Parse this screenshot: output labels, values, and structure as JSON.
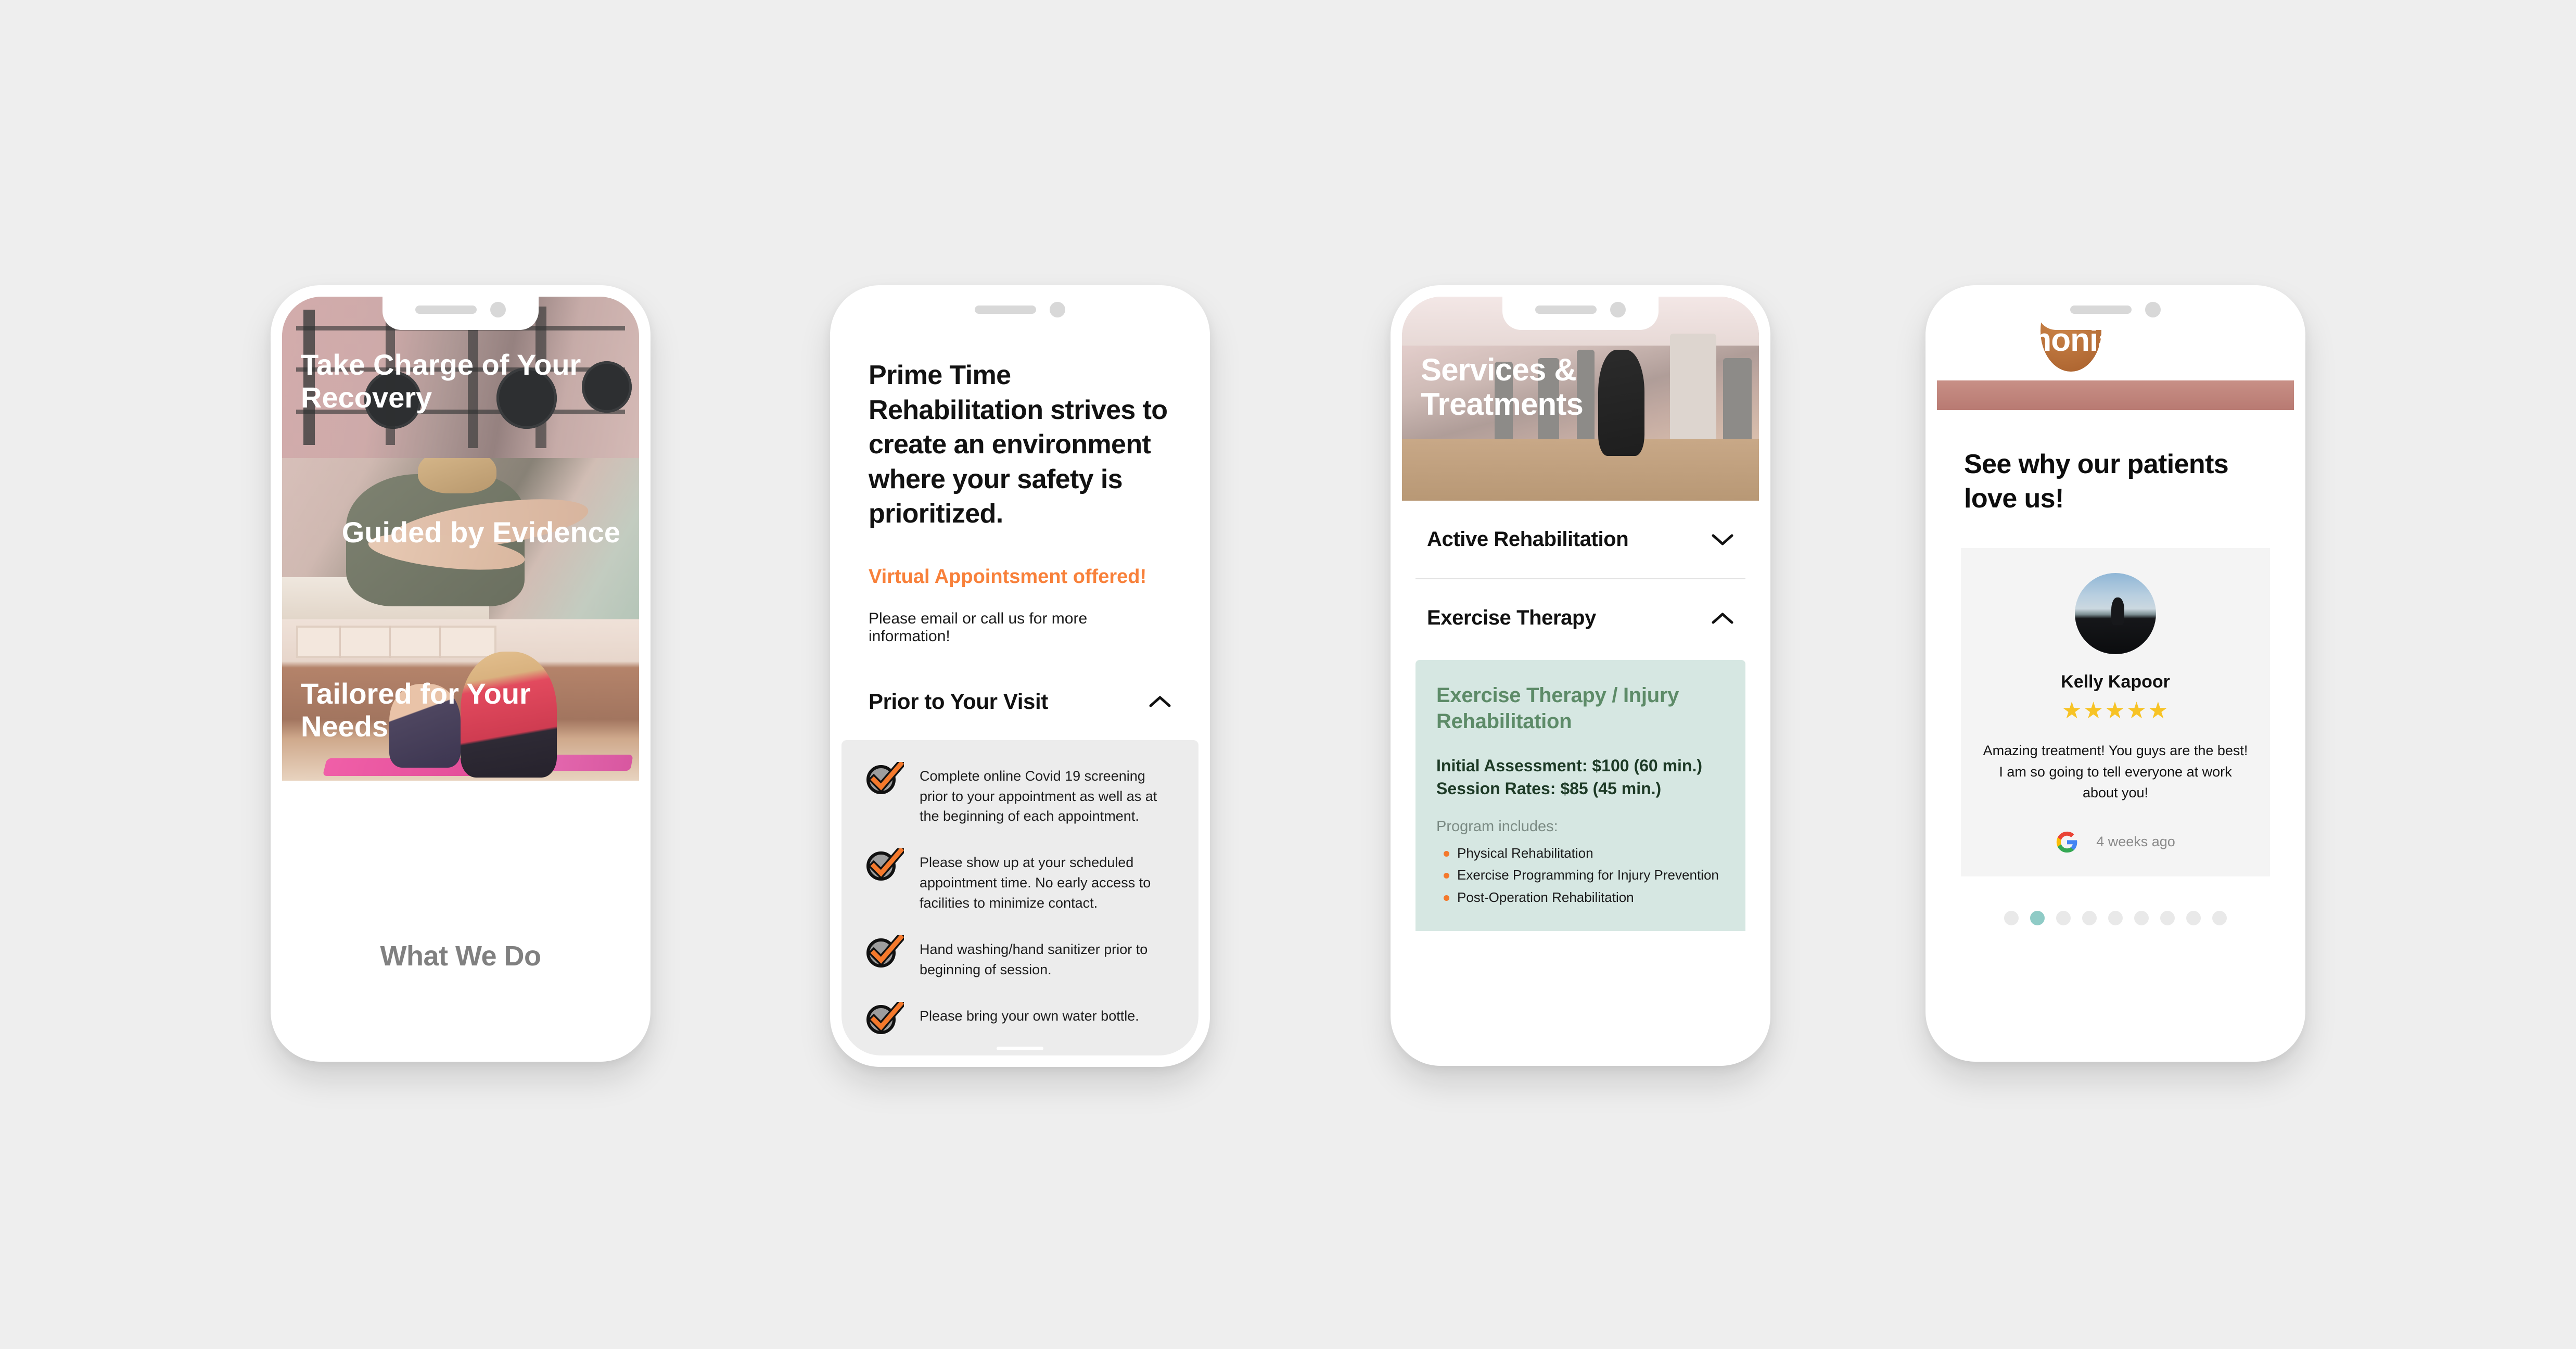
{
  "background_color": "#eeeeee",
  "accent_colors": {
    "orange": "#f8813b",
    "green_text": "#5d8b68",
    "green_panel": "#d6e7e2",
    "teal_dot": "#8fcbc6",
    "star_yellow": "#f7c325",
    "gray_text": "#808080"
  },
  "phone1": {
    "name": "what-we-do-slides",
    "slides": [
      {
        "caption": "Take Charge of Your Recovery",
        "align": "left",
        "image": "gym-squat-rack-photo"
      },
      {
        "caption": "Guided by Evidence",
        "align": "right",
        "image": "therapist-back-treatment-photo"
      },
      {
        "caption": "Tailored for Your Needs",
        "align": "left",
        "image": "women-stretching-on-mats-photo"
      }
    ],
    "section_label": "What We Do"
  },
  "phone2": {
    "name": "safety-prior-to-visit",
    "headline": "Prime Time Rehabilitation strives to create an environment where your safety is prioritized.",
    "virtual_notice": "Virtual Appointsment offered!",
    "subtext": "Please email or call us for more information!",
    "accordion": {
      "label": "Prior to Your Visit",
      "state": "expanded",
      "chevron": "chevron-up-icon"
    },
    "checklist": [
      "Complete online Covid 19 screening prior to your appointment as well as at the beginning of each appointment.",
      "Please show up at your scheduled appointment time. No early access to facilities to minimize contact.",
      "Hand washing/hand sanitizer prior to beginning of session.",
      "Please bring your own water bottle."
    ]
  },
  "phone3": {
    "name": "services-and-treatments",
    "hero_title": "Services & Treatments",
    "hero_image": "gym-interior-photo",
    "accordions": [
      {
        "label": "Active Rehabilitation",
        "state": "collapsed",
        "chevron": "chevron-down-icon"
      },
      {
        "label": "Exercise Therapy",
        "state": "expanded",
        "chevron": "chevron-up-icon"
      }
    ],
    "panel": {
      "title": "Exercise Therapy / Injury Rehabilitation",
      "rate_line_1": "Initial Assessment: $100 (60 min.)",
      "rate_line_2": "Session Rates: $85 (45 min.)",
      "includes_label": "Program includes:",
      "includes": [
        "Physical Rehabilitation",
        "Exercise Programming for Injury Prevention",
        "Post-Operation Rehabilitation"
      ]
    }
  },
  "phone4": {
    "name": "testimonials",
    "hero_title": "Testimonials",
    "hero_image": "people-with-basketball-photo",
    "headline": "See why our patients love us!",
    "review": {
      "avatar": "person-at-sunset-avatar",
      "author": "Kelly Kapoor",
      "rating": 5,
      "stars": "★★★★★",
      "text": "Amazing treatment! You guys are the best! I am so going to tell everyone at work about you!",
      "source_icon": "google-logo-icon",
      "time_ago": "4 weeks ago"
    },
    "pagination": {
      "total": 9,
      "active_index": 1
    }
  }
}
